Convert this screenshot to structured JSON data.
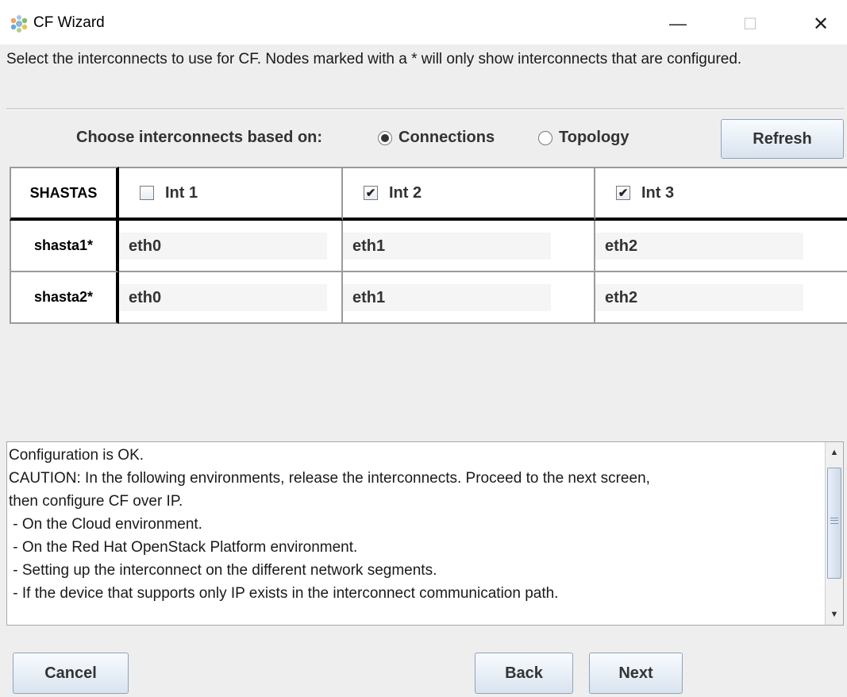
{
  "window": {
    "title": "CF Wizard",
    "minimize_glyph": "—",
    "maximize_glyph": "☐",
    "close_glyph": "✕",
    "icon": "gear-flower-icon"
  },
  "instructions": "Select the interconnects to use for CF.  Nodes marked with a * will only show interconnects that are configured.",
  "choose": {
    "label": "Choose interconnects based on:",
    "options": [
      {
        "label": "Connections",
        "selected": true
      },
      {
        "label": "Topology",
        "selected": false
      }
    ],
    "refresh_label": "Refresh"
  },
  "grid": {
    "corner_label": "SHASTAS",
    "interconnects": [
      {
        "label": "Int 1",
        "checked": false
      },
      {
        "label": "Int 2",
        "checked": true
      },
      {
        "label": "Int 3",
        "checked": true
      }
    ],
    "check_glyph": "✔",
    "rows": [
      {
        "node": "shasta1*",
        "values": [
          "eth0",
          "eth1",
          "eth2"
        ]
      },
      {
        "node": "shasta2*",
        "values": [
          "eth0",
          "eth1",
          "eth2"
        ]
      }
    ]
  },
  "messages": [
    "Configuration is OK.",
    "CAUTION: In the following environments, release the interconnects. Proceed to the next screen,",
    "then configure CF over IP.",
    " - On the Cloud environment.",
    " - On the Red Hat OpenStack Platform environment.",
    " - Setting up the interconnect on the different network segments.",
    " - If the device that supports only IP exists in the interconnect communication path."
  ],
  "scroll_glyphs": {
    "up": "▲",
    "down": "▼"
  },
  "buttons": {
    "cancel": "Cancel",
    "back": "Back",
    "next": "Next"
  },
  "colors": {
    "panel_bg": "#eeeeee",
    "button_border": "#8ea3bd"
  }
}
